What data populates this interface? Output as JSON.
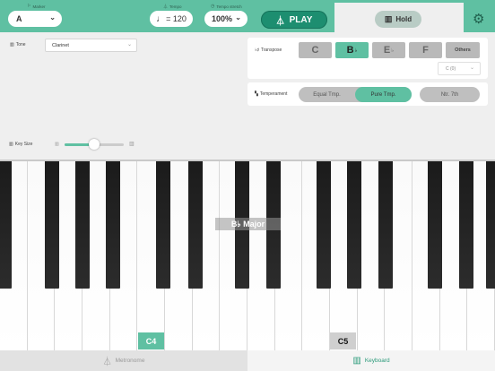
{
  "header": {
    "marker": {
      "label": "Marker",
      "value": "A"
    },
    "tempo": {
      "label": "Tempo",
      "value": "= 120"
    },
    "tempo_stretch": {
      "label": "Tempo stretch",
      "value": "100%"
    },
    "play_label": "PLAY",
    "hold_label": "Hold"
  },
  "tone": {
    "label": "Tone",
    "value": "Clarinet"
  },
  "transpose": {
    "label": "Transpose",
    "keys": [
      {
        "name": "C",
        "accidental": ""
      },
      {
        "name": "B",
        "accidental": "♭"
      },
      {
        "name": "E",
        "accidental": "♭"
      },
      {
        "name": "F",
        "accidental": ""
      }
    ],
    "selected": "B♭",
    "others_label": "Others",
    "octave_value": "C (0)"
  },
  "temperament": {
    "label": "Temperament",
    "options": [
      "Equal Tmp.",
      "Pure Tmp."
    ],
    "selected": "Pure Tmp.",
    "extra_option": "Ntr. 7th"
  },
  "key_size": {
    "label": "Key Size",
    "value": 0.5
  },
  "keyboard": {
    "scale_label": "B♭ Major",
    "marked_keys": [
      "C4",
      "C5"
    ]
  },
  "tabs": [
    {
      "label": "Metronome",
      "active": false
    },
    {
      "label": "Keyboard",
      "active": true
    }
  ],
  "colors": {
    "accent": "#5fc0a2",
    "play": "#1d8e70",
    "inactive": "#b9b9b9"
  }
}
